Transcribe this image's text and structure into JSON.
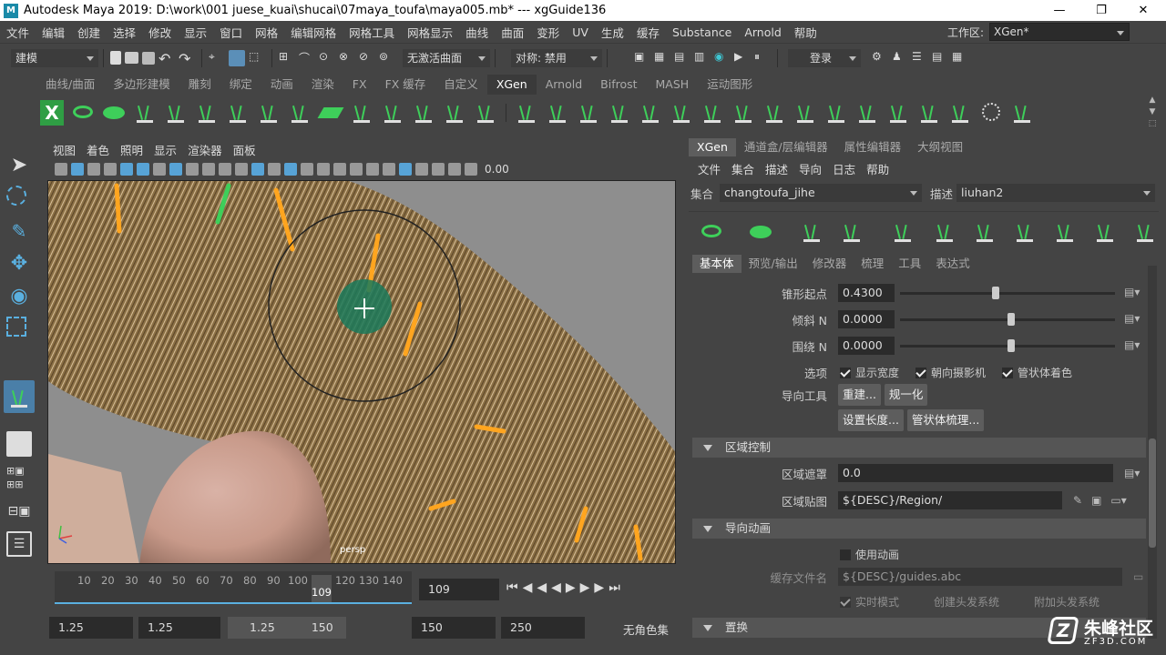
{
  "title_bar": {
    "title": "Autodesk Maya 2019: D:\\work\\001 juese_kuai\\shucai\\07maya_toufa\\maya005.mb*   ---   xgGuide136",
    "minimize": "—",
    "restore": "❐",
    "close": "✕"
  },
  "menu": {
    "items": [
      "文件",
      "编辑",
      "创建",
      "选择",
      "修改",
      "显示",
      "窗口",
      "网格",
      "编辑网格",
      "网格工具",
      "网格显示",
      "曲线",
      "曲面",
      "变形",
      "UV",
      "生成",
      "缓存",
      "Substance",
      "Arnold",
      "帮助"
    ]
  },
  "workspace": {
    "label": "工作区:",
    "value": "XGen*"
  },
  "status_line": {
    "mode": "建模",
    "live_surface": "无激活曲面",
    "symmetry": "对称: 禁用",
    "login": "登录"
  },
  "shelf": {
    "tabs": [
      "曲线/曲面",
      "多边形建模",
      "雕刻",
      "绑定",
      "动画",
      "渲染",
      "FX",
      "FX 缓存",
      "自定义",
      "XGen",
      "Arnold",
      "Bifrost",
      "MASH",
      "运动图形"
    ],
    "active_tab": "XGen"
  },
  "viewport": {
    "menu": [
      "视图",
      "着色",
      "照明",
      "显示",
      "渲染器",
      "面板"
    ],
    "field_value": "0.00",
    "camera_label": "persp"
  },
  "timeline": {
    "ticks": [
      "10",
      "20",
      "30",
      "40",
      "50",
      "60",
      "70",
      "80",
      "90",
      "100",
      "110",
      "120",
      "130",
      "140"
    ],
    "current_frame_marker": "109",
    "current_frame": "109"
  },
  "range": {
    "start": "1.25",
    "start2": "1.25",
    "slider_start": "1.25",
    "slider_end": "150",
    "end": "150",
    "end2": "250",
    "charset": "无角色集"
  },
  "xgen": {
    "tabs": [
      "XGen",
      "通道盒/层编辑器",
      "属性编辑器",
      "大纲视图"
    ],
    "menu": [
      "文件",
      "集合",
      "描述",
      "导向",
      "日志",
      "帮助"
    ],
    "collection_label": "集合",
    "collection_value": "changtoufa_jihe",
    "description_label": "描述",
    "description_value": "liuhan2",
    "subtabs": [
      "基本体",
      "预览/输出",
      "修改器",
      "梳理",
      "工具",
      "表达式"
    ],
    "taper_start": {
      "label": "锥形起点",
      "value": "0.4300",
      "fraction": 0.43
    },
    "tilt": {
      "label": "倾斜 N",
      "value": "0.0000",
      "fraction": 0.5
    },
    "twist": {
      "label": "围绕 N",
      "value": "0.0000",
      "fraction": 0.5
    },
    "options": {
      "label": "选项",
      "show_width": "显示宽度",
      "face_camera": "朝向摄影机",
      "tube_shade": "管状体着色"
    },
    "guide_tools": {
      "label": "导向工具",
      "rebuild": "重建...",
      "normalize": "规一化",
      "set_length": "设置长度...",
      "tube_comb": "管状体梳理..."
    },
    "region_section": "区域控制",
    "region_mask": {
      "label": "区域遮罩",
      "value": "0.0"
    },
    "region_map": {
      "label": "区域贴图",
      "value": "${DESC}/Region/"
    },
    "guide_anim_section": "导向动画",
    "use_anim": "使用动画",
    "cache_file": {
      "label": "缓存文件名",
      "value": "${DESC}/guides.abc"
    },
    "live_mode": "实时模式",
    "create_hair": "创建头发系统",
    "attach_hair": "附加头发系统",
    "replace_section": "置换"
  },
  "watermark": {
    "text": "朱峰社区",
    "sub": "ZF3D.COM"
  }
}
